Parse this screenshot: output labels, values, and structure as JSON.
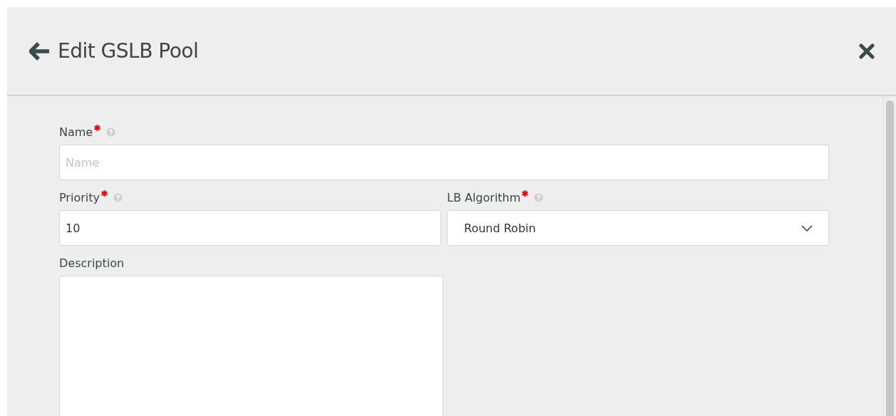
{
  "header": {
    "title": "Edit GSLB Pool"
  },
  "fields": [
    {
      "kind": "text",
      "label": "Name",
      "required": true,
      "help": true,
      "placeholder": "Name"
    },
    {
      "kind": "text",
      "label": "Priority",
      "required": true,
      "help": true,
      "value": "10"
    },
    {
      "kind": "select",
      "label": "LB Algorithm",
      "required": true,
      "help": true,
      "value": "Round Robin"
    },
    {
      "kind": "textarea",
      "label": "Description",
      "required": false,
      "help": false
    }
  ]
}
